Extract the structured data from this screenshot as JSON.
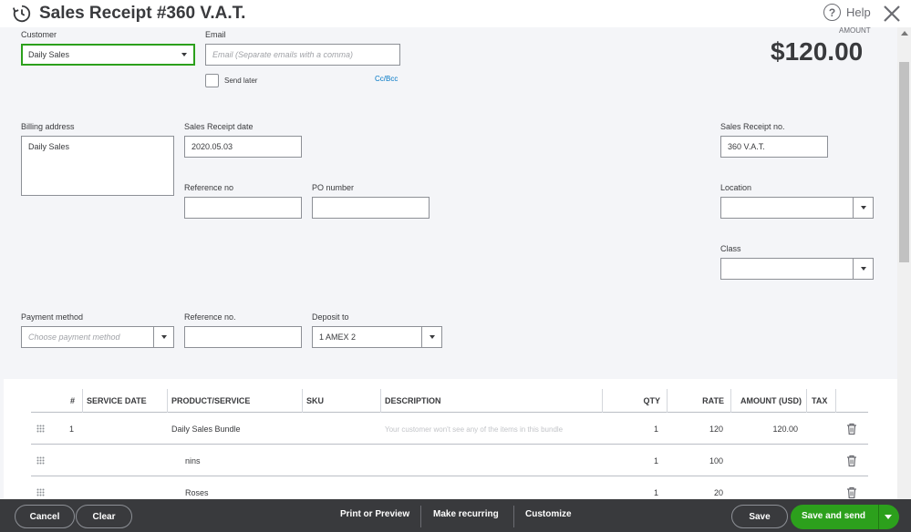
{
  "header": {
    "title": "Sales Receipt #360 V.A.T.",
    "help_label": "Help",
    "history_icon": "history-clock-icon",
    "help_icon": "question-circle-icon",
    "close_icon": "close-icon"
  },
  "form": {
    "customer": {
      "label": "Customer",
      "value": "Daily Sales"
    },
    "email": {
      "label": "Email",
      "placeholder": "Email (Separate emails with a comma)"
    },
    "send_later_label": "Send later",
    "cc_bcc_label": "Cc/Bcc",
    "amount_label": "AMOUNT",
    "amount": "$120.00",
    "billing_address": {
      "label": "Billing address",
      "value": "Daily Sales"
    },
    "receipt_date": {
      "label": "Sales Receipt date",
      "value": "2020.05.03"
    },
    "receipt_no": {
      "label": "Sales Receipt no.",
      "value": "360 V.A.T."
    },
    "reference_no": {
      "label": "Reference no",
      "value": ""
    },
    "po_number": {
      "label": "PO number",
      "value": ""
    },
    "location": {
      "label": "Location",
      "value": ""
    },
    "class": {
      "label": "Class",
      "value": ""
    },
    "payment_method": {
      "label": "Payment method",
      "placeholder": "Choose payment method"
    },
    "payment_reference": {
      "label": "Reference no.",
      "value": ""
    },
    "deposit_to": {
      "label": "Deposit to",
      "value": "1 AMEX 2"
    }
  },
  "table": {
    "headers": {
      "num": "#",
      "service_date": "SERVICE DATE",
      "product": "PRODUCT/SERVICE",
      "sku": "SKU",
      "description": "DESCRIPTION",
      "qty": "QTY",
      "rate": "RATE",
      "amount": "AMOUNT (USD)",
      "tax": "TAX"
    },
    "rows": [
      {
        "num": "1",
        "product": "Daily Sales Bundle",
        "description": "Your customer won't see any of the items in this bundle",
        "qty": "1",
        "rate": "120",
        "amount": "120.00"
      },
      {
        "num": "",
        "product": "nins",
        "description": "",
        "qty": "1",
        "rate": "100",
        "amount": ""
      },
      {
        "num": "",
        "product": "Roses",
        "description": "",
        "qty": "1",
        "rate": "20",
        "amount": ""
      }
    ]
  },
  "footer": {
    "cancel": "Cancel",
    "clear": "Clear",
    "print_preview": "Print or Preview",
    "make_recurring": "Make recurring",
    "customize": "Customize",
    "save": "Save",
    "save_and_send": "Save and send"
  },
  "colors": {
    "accent_green": "#2ca01c",
    "footer_bg": "#393a3d",
    "link_blue": "#0077c5"
  }
}
